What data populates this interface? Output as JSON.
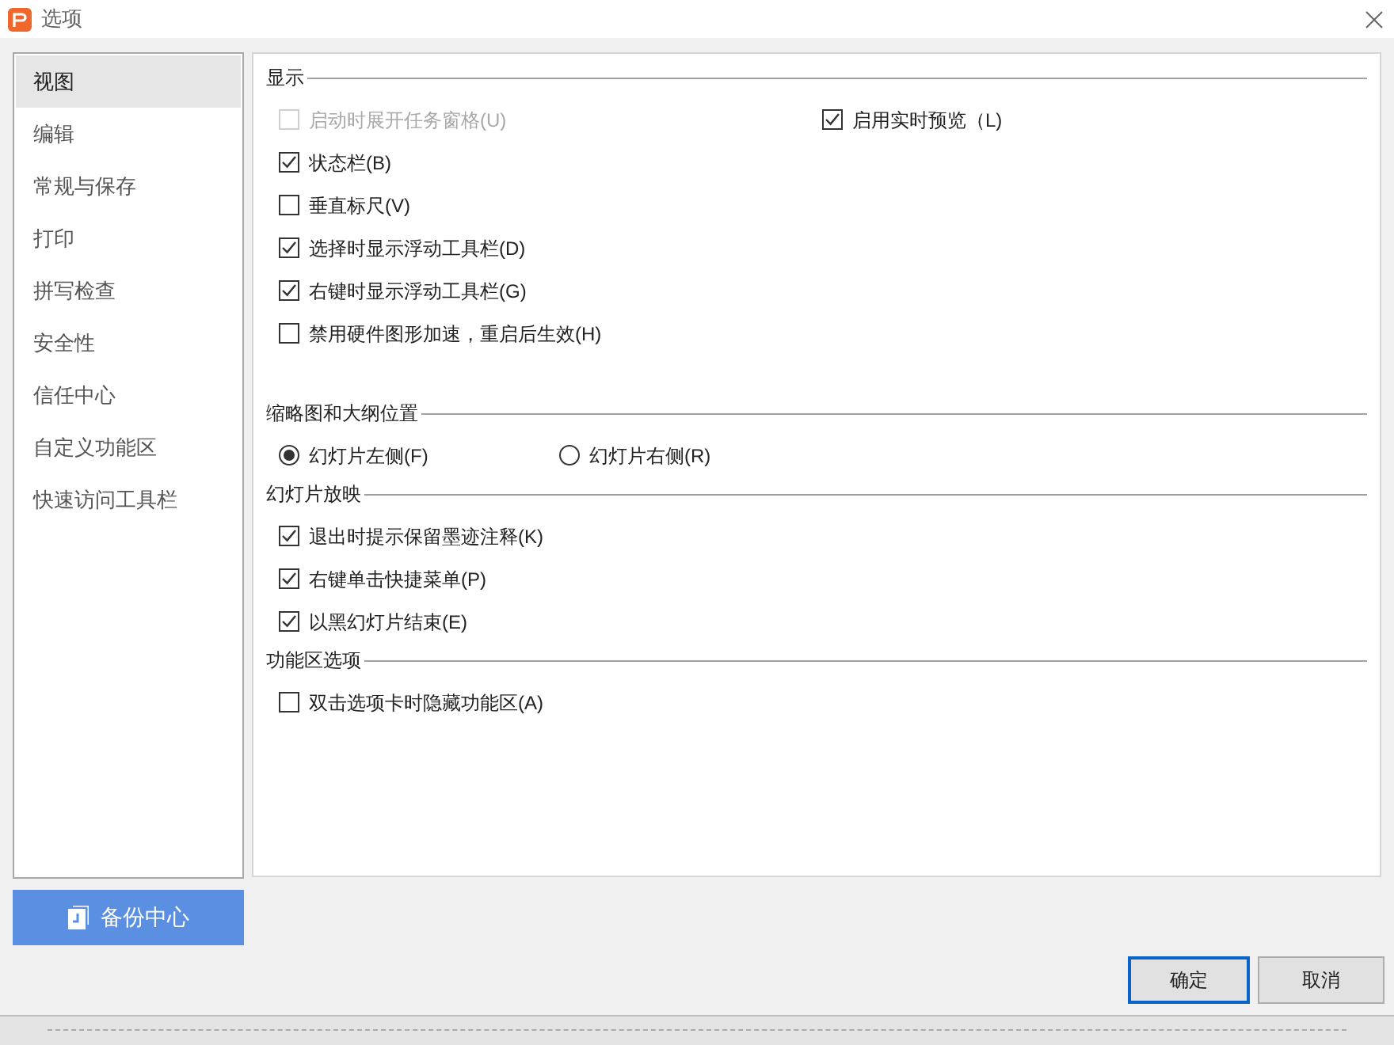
{
  "window": {
    "title": "选项"
  },
  "sidebar": {
    "items": [
      {
        "label": "视图",
        "selected": true
      },
      {
        "label": "编辑",
        "selected": false
      },
      {
        "label": "常规与保存",
        "selected": false
      },
      {
        "label": "打印",
        "selected": false
      },
      {
        "label": "拼写检查",
        "selected": false
      },
      {
        "label": "安全性",
        "selected": false
      },
      {
        "label": "信任中心",
        "selected": false
      },
      {
        "label": "自定义功能区",
        "selected": false
      },
      {
        "label": "快速访问工具栏",
        "selected": false
      }
    ]
  },
  "backup_button": "备份中心",
  "sections": [
    {
      "title": "显示",
      "kind": "checklist",
      "items": [
        {
          "label": "启动时展开任务窗格(U)",
          "checked": false,
          "disabled": true
        },
        {
          "label": "状态栏(B)",
          "checked": true,
          "disabled": false
        },
        {
          "label": "垂直标尺(V)",
          "checked": false,
          "disabled": false
        },
        {
          "label": "选择时显示浮动工具栏(D)",
          "checked": true,
          "disabled": false
        },
        {
          "label": "右键时显示浮动工具栏(G)",
          "checked": true,
          "disabled": false
        },
        {
          "label": "禁用硬件图形加速，重启后生效(H)",
          "checked": false,
          "disabled": false
        }
      ],
      "side_items": [
        {
          "label": "启用实时预览（L)",
          "checked": true,
          "disabled": false
        }
      ]
    },
    {
      "title": "缩略图和大纲位置",
      "kind": "radio_row",
      "items": [
        {
          "label": "幻灯片左侧(F)",
          "selected": true
        },
        {
          "label": "幻灯片右侧(R)",
          "selected": false
        }
      ]
    },
    {
      "title": "幻灯片放映",
      "kind": "checklist",
      "items": [
        {
          "label": "退出时提示保留墨迹注释(K)",
          "checked": true,
          "disabled": false
        },
        {
          "label": "右键单击快捷菜单(P)",
          "checked": true,
          "disabled": false
        },
        {
          "label": "以黑幻灯片结束(E)",
          "checked": true,
          "disabled": false
        }
      ]
    },
    {
      "title": "功能区选项",
      "kind": "checklist",
      "items": [
        {
          "label": "双击选项卡时隐藏功能区(A)",
          "checked": false,
          "disabled": false
        }
      ]
    }
  ],
  "buttons": [
    {
      "label": "确定",
      "kind": "default"
    },
    {
      "label": "取消",
      "kind": "normal"
    }
  ]
}
